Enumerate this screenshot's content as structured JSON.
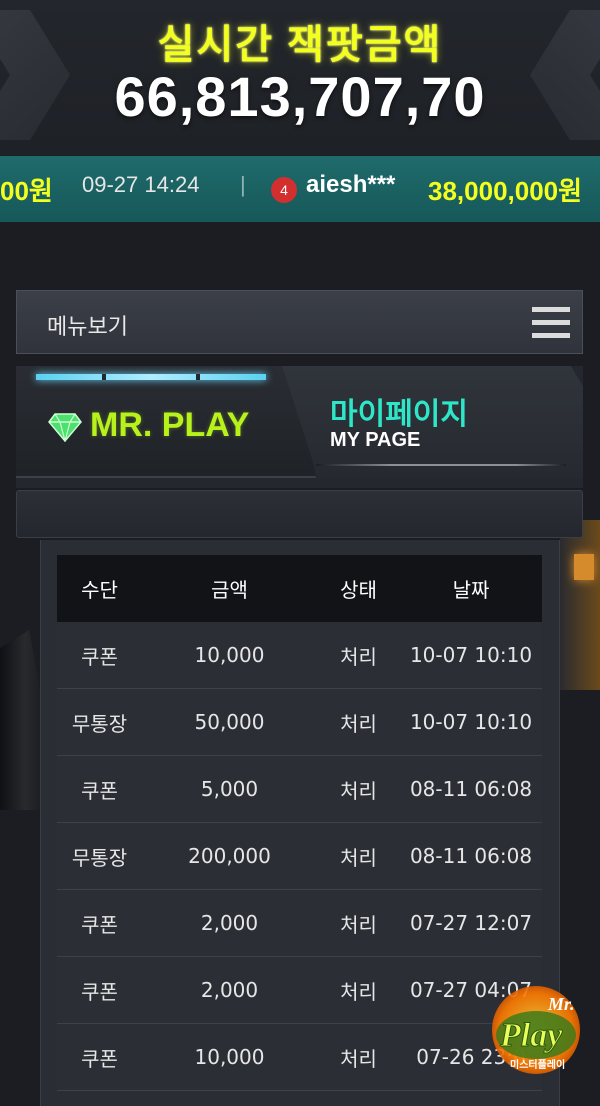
{
  "jackpot": {
    "title": "실시간 잭팟금액",
    "amount": "66,813,707,70"
  },
  "ticker": {
    "prev_amount_tail": "00원",
    "date": "09-27 14:24",
    "separator": "|",
    "rank": "4",
    "user": "aiesh***",
    "amount": "38,000,000원"
  },
  "menu": {
    "label": "메뉴보기"
  },
  "brand": {
    "name": "MR. PLAY"
  },
  "page": {
    "title_ko": "마이페이지",
    "title_en": "MY PAGE"
  },
  "table": {
    "headers": [
      "수단",
      "금액",
      "상태",
      "날짜"
    ],
    "rows": [
      [
        "쿠폰",
        "10,000",
        "처리",
        "10-07 10:10"
      ],
      [
        "무통장",
        "50,000",
        "처리",
        "10-07 10:10"
      ],
      [
        "쿠폰",
        "5,000",
        "처리",
        "08-11 06:08"
      ],
      [
        "무통장",
        "200,000",
        "처리",
        "08-11 06:08"
      ],
      [
        "쿠폰",
        "2,000",
        "처리",
        "07-27 12:07"
      ],
      [
        "쿠폰",
        "2,000",
        "처리",
        "07-27 04:07"
      ],
      [
        "쿠폰",
        "10,000",
        "처리",
        "07-26 23:0"
      ]
    ]
  },
  "logo_badge": {
    "text_top": "Mr.",
    "text_main": "Play",
    "text_sub": "미스터플레이"
  },
  "colors": {
    "jackpot_yellow": "#f3ff1f",
    "ticker_teal": "#1f6b6c",
    "brand_green": "#b8f21c",
    "mypage_teal": "#2ee6c8",
    "table_header_bg": "#121317",
    "table_row_bg": "#2b2e35",
    "badge_red": "#d42f2f"
  }
}
